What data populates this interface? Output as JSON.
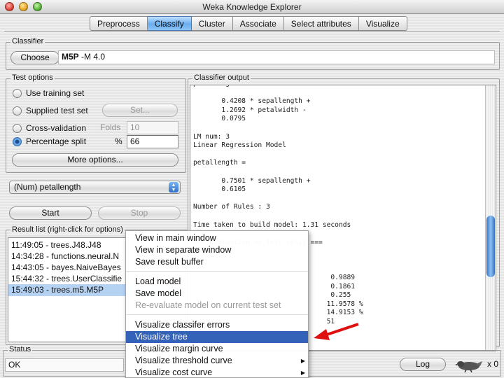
{
  "window": {
    "title": "Weka Knowledge Explorer"
  },
  "tabs": [
    {
      "label": "Preprocess",
      "active": false
    },
    {
      "label": "Classify",
      "active": true
    },
    {
      "label": "Cluster",
      "active": false
    },
    {
      "label": "Associate",
      "active": false
    },
    {
      "label": "Select attributes",
      "active": false
    },
    {
      "label": "Visualize",
      "active": false
    }
  ],
  "classifier": {
    "group_label": "Classifier",
    "choose_label": "Choose",
    "name": "M5P",
    "options": " -M 4.0"
  },
  "test_options": {
    "group_label": "Test options",
    "use_training_set": "Use training set",
    "supplied_test_set": "Supplied test set",
    "set_button": "Set...",
    "cross_validation": "Cross-validation",
    "folds_label": "Folds",
    "folds_value": "10",
    "percentage_split": "Percentage split",
    "percent_symbol": "%",
    "percent_value": "66",
    "more_options": "More options...",
    "selected": "percentage_split"
  },
  "class_selector": {
    "value": "(Num) petallength"
  },
  "run": {
    "start_label": "Start",
    "stop_label": "Stop"
  },
  "result_list": {
    "group_label": "Result list (right-click for options)",
    "items": [
      "11:49:05 - trees.J48.J48",
      "14:34:28 - functions.neural.N",
      "14:43:05 - bayes.NaiveBayes",
      "15:44:32 - trees.UserClassifie",
      "15:49:03 - trees.m5.M5P"
    ],
    "selected_index": 4
  },
  "output": {
    "group_label": "Classifier output",
    "lines": [
      "petallength =",
      "",
      "       0.4208 * sepallength +",
      "       1.2692 * petalwidth -",
      "       0.0795",
      "",
      "LM num: 3",
      "Linear Regression Model",
      "",
      "petallength =",
      "",
      "       0.7501 * sepallength +",
      "       0.6105",
      "",
      "Number of Rules : 3",
      "",
      "Time taken to build model: 1.31 seconds",
      "",
      "=== Evaluation on test split ===",
      "",
      "",
      "",
      "                                  0.9889",
      "                                  0.1861",
      "                                  0.255",
      "                                 11.9578 %",
      "                                 14.9153 %",
      "                                 51"
    ]
  },
  "context_menu": {
    "items": [
      {
        "label": "View in main window",
        "state": "normal"
      },
      {
        "label": "View in separate window",
        "state": "normal"
      },
      {
        "label": "Save result buffer",
        "state": "normal"
      },
      {
        "label": "Load model",
        "state": "normal"
      },
      {
        "label": "Save model",
        "state": "normal"
      },
      {
        "label": "Re-evaluate model on current test set",
        "state": "disabled"
      },
      {
        "label": "Visualize classifer errors",
        "state": "normal"
      },
      {
        "label": "Visualize tree",
        "state": "highlighted"
      },
      {
        "label": "Visualize margin curve",
        "state": "normal"
      },
      {
        "label": "Visualize threshold curve",
        "state": "submenu"
      },
      {
        "label": "Visualize cost curve",
        "state": "submenu"
      }
    ]
  },
  "status": {
    "group_label": "Status",
    "text": "OK",
    "log_label": "Log",
    "x_count": "x 0"
  },
  "colors": {
    "annotation_arrow": "#e01010",
    "selection_blue": "#3462b8",
    "tab_active_blue": "#6aaef0"
  }
}
